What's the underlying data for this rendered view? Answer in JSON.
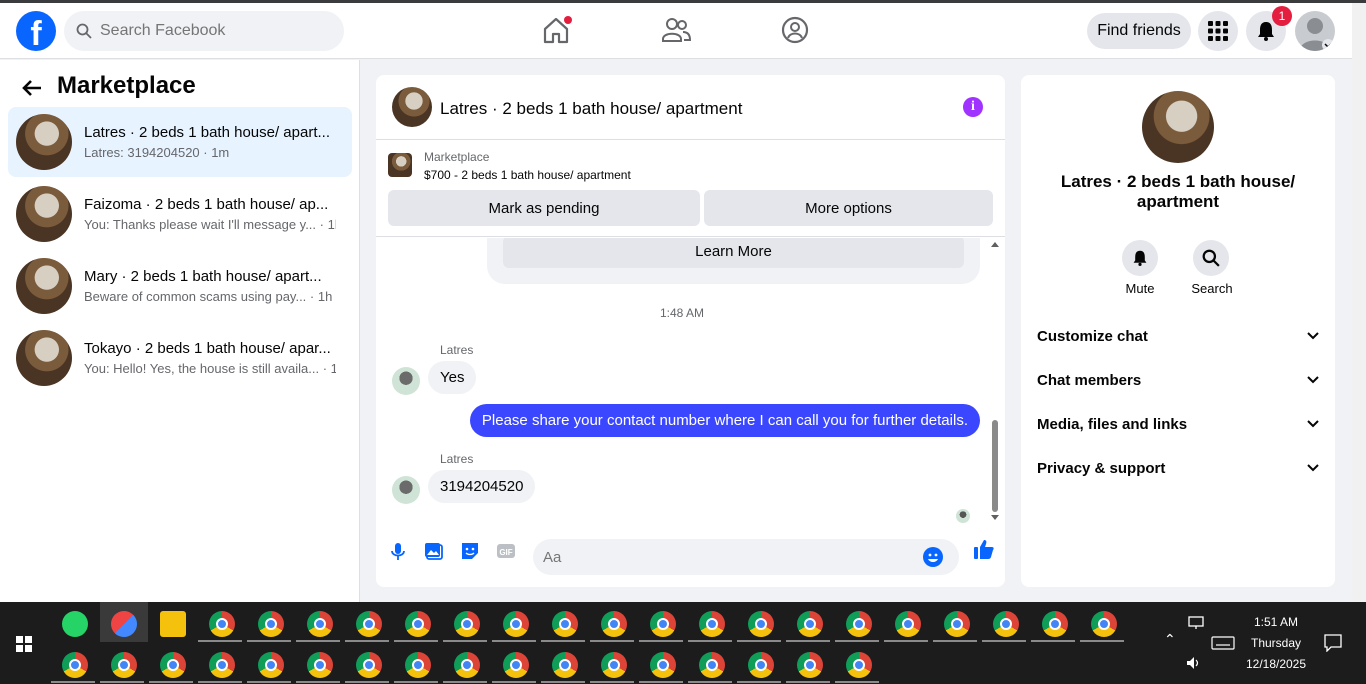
{
  "header": {
    "logo_letter": "f",
    "search_placeholder": "Search Facebook",
    "find_friends_label": "Find friends",
    "notification_count": "1"
  },
  "sidebar": {
    "title": "Marketplace",
    "conversations": [
      {
        "name": "Latres · 2 beds 1 bath house/ apart...",
        "snippet": "Latres: 3194204520 · 1m"
      },
      {
        "name": "Faizoma · 2 beds 1 bath house/ ap...",
        "snippet": "You: Thanks please wait I'll message y... · 1h"
      },
      {
        "name": "Mary · 2 beds 1 bath house/ apart...",
        "snippet": "Beware of common scams using pay... · 1h"
      },
      {
        "name": "Tokayo · 2 beds 1 bath house/ apar...",
        "snippet": "You: Hello! Yes, the house is still availa... · 1h"
      }
    ]
  },
  "chat": {
    "title": "Latres · 2 beds 1 bath house/ apartment",
    "info_glyph": "i",
    "marketplace_label": "Marketplace",
    "listing": "$700 - 2 beds 1 bath house/ apartment",
    "mark_pending_label": "Mark as pending",
    "more_options_label": "More options",
    "learn_more_label": "Learn More",
    "timestamp": "1:48 AM",
    "messages": [
      {
        "sender": "Latres",
        "text": "Yes",
        "direction": "in"
      },
      {
        "sender": "",
        "text": "Please share your contact number where I can call you for further details.",
        "direction": "out"
      },
      {
        "sender": "Latres",
        "text": "3194204520",
        "direction": "in"
      }
    ],
    "composer_placeholder": "Aa"
  },
  "info_panel": {
    "title": "Latres · 2 beds 1 bath house/ apartment",
    "mute_label": "Mute",
    "search_label": "Search",
    "sections": [
      "Customize chat",
      "Chat members",
      "Media, files and links",
      "Privacy & support"
    ]
  },
  "taskbar": {
    "time": "1:51 AM",
    "day": "Thursday",
    "date": "12/18/2025"
  },
  "colors": {
    "brand": "#0866ff",
    "outgoing_bubble": "#3a47ff",
    "info_icon": "#a033ff",
    "badge": "#e41e3f"
  }
}
